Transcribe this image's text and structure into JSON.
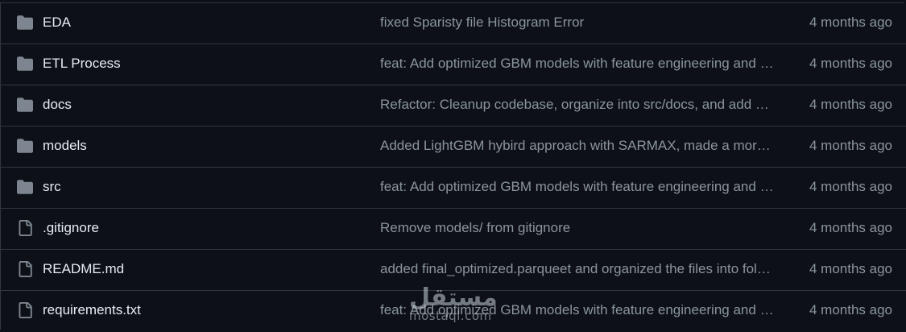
{
  "files": [
    {
      "type": "folder",
      "name": "EDA",
      "message": "fixed Sparisty file Histogram Error",
      "age": "4 months ago"
    },
    {
      "type": "folder",
      "name": "ETL Process",
      "message": "feat: Add optimized GBM models with feature engineering and hyperparameter tuning",
      "age": "4 months ago"
    },
    {
      "type": "folder",
      "name": "docs",
      "message": "Refactor: Cleanup codebase, organize into src/docs, and add documentation",
      "age": "4 months ago"
    },
    {
      "type": "folder",
      "name": "models",
      "message": "Added LightGBM hybird approach with SARMAX, made a more robust forecast",
      "age": "4 months ago"
    },
    {
      "type": "folder",
      "name": "src",
      "message": "feat: Add optimized GBM models with feature engineering and hyperparameter tuning",
      "age": "4 months ago"
    },
    {
      "type": "file",
      "name": ".gitignore",
      "message": "Remove models/ from gitignore",
      "age": "4 months ago"
    },
    {
      "type": "file",
      "name": "README.md",
      "message": "added final_optimized.parqueet and organized the files into folders",
      "age": "4 months ago"
    },
    {
      "type": "file",
      "name": "requirements.txt",
      "message": "feat: Add optimized GBM models with feature engineering and hyperparameter tuning",
      "age": "4 months ago"
    }
  ],
  "watermark": {
    "arabic": "مستقل",
    "latin": "mostaql.com"
  },
  "colors": {
    "background": "#0d1117",
    "border": "#30363d",
    "primary_text": "#e6edf3",
    "secondary_text": "#8b949e",
    "folder_icon": "#7d8590"
  }
}
